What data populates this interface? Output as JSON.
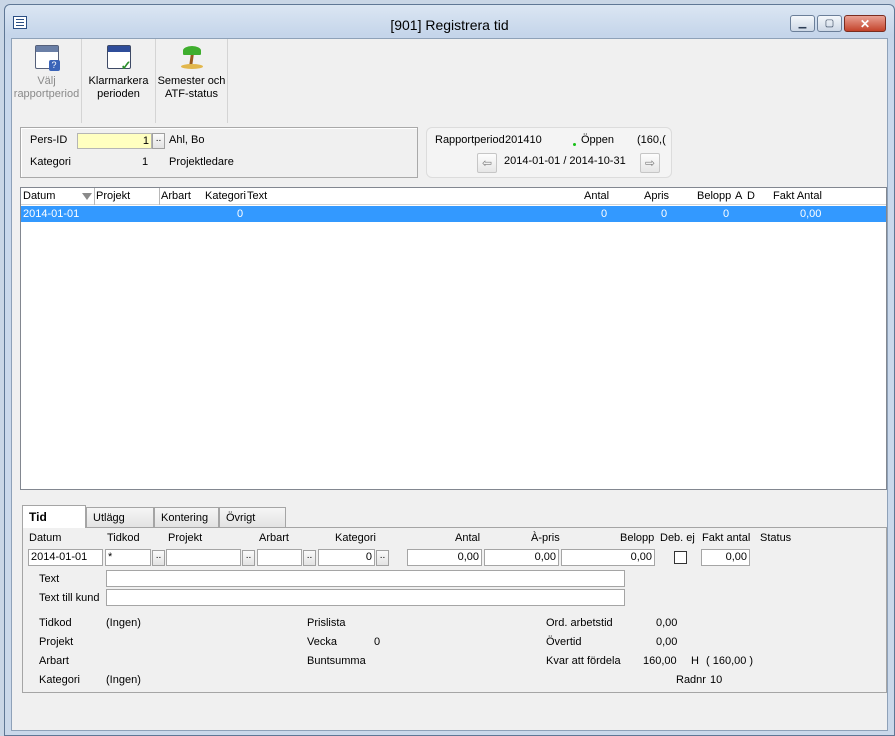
{
  "window": {
    "title": "[901]  Registrera tid",
    "minimize": "▁",
    "maximize": "▢",
    "close": "✕"
  },
  "toolbar": {
    "items": [
      {
        "line1": "Välj",
        "line2": "rapportperiod",
        "icon": "calendar-question-icon",
        "enabled": false
      },
      {
        "line1": "Klarmarkera",
        "line2": "perioden",
        "icon": "calendar-check-icon",
        "enabled": true
      },
      {
        "line1": "Semester och",
        "line2": "ATF-status",
        "icon": "palm-tree-icon",
        "enabled": true
      }
    ]
  },
  "person": {
    "pers_id_label": "Pers-ID",
    "pers_id_value": "1",
    "name": "Ahl, Bo",
    "kategori_label": "Kategori",
    "kategori_value": "1",
    "kategori_name": "Projektledare",
    "lookup": ".."
  },
  "report_period": {
    "label": "Rapportperiod",
    "value": "201410",
    "status": "Öppen",
    "hours": "(160,(",
    "range": "2014-01-01 / 2014-10-31",
    "prev": "⇦",
    "next": "⇨",
    "status_color": "#18c018"
  },
  "grid": {
    "columns": [
      "Datum",
      "Projekt",
      "Arbart",
      "Kategori",
      "Text",
      "Antal",
      "Apris",
      "Belopp",
      "A",
      "D",
      "Fakt Antal"
    ],
    "rows": [
      {
        "datum": "2014-01-01",
        "kategori": "0",
        "antal": "0",
        "apris": "0",
        "belopp": "0",
        "fakt_antal": "0,00",
        "selected": true
      }
    ],
    "selection_color": "#3399ff"
  },
  "tabs": [
    "Tid",
    "Utlägg",
    "Kontering",
    "Övrigt"
  ],
  "form": {
    "headers": {
      "datum": "Datum",
      "tidkod": "Tidkod",
      "projekt": "Projekt",
      "arbart": "Arbart",
      "kategori": "Kategori",
      "antal": "Antal",
      "apris": "À-pris",
      "belopp": "Belopp",
      "debej": "Deb. ej",
      "fakt_antal": "Fakt antal",
      "status": "Status"
    },
    "values": {
      "datum": "2014-01-01",
      "tidkod": "*",
      "projekt": "",
      "arbart": "",
      "kategori": "0",
      "antal": "0,00",
      "apris": "0,00",
      "belopp": "0,00",
      "fakt_antal": "0,00"
    },
    "text_label": "Text",
    "text_value": "",
    "text_kund_label": "Text till kund",
    "text_kund_value": "",
    "info": {
      "tidkod_label": "Tidkod",
      "tidkod_value": "(Ingen)",
      "projekt_label": "Projekt",
      "arbart_label": "Arbart",
      "kategori_label": "Kategori",
      "kategori_value": "(Ingen)",
      "prislista_label": "Prislista",
      "vecka_label": "Vecka",
      "vecka_value": "0",
      "buntsumma_label": "Buntsumma",
      "ord_label": "Ord. arbetstid",
      "ord_value": "0,00",
      "overtid_label": "Övertid",
      "overtid_value": "0,00",
      "kvar_label": "Kvar att fördela",
      "kvar_value": "160,00",
      "kvar_unit": "H",
      "kvar_total": "( 160,00 )",
      "radnr_label": "Radnr",
      "radnr_value": "10"
    }
  }
}
